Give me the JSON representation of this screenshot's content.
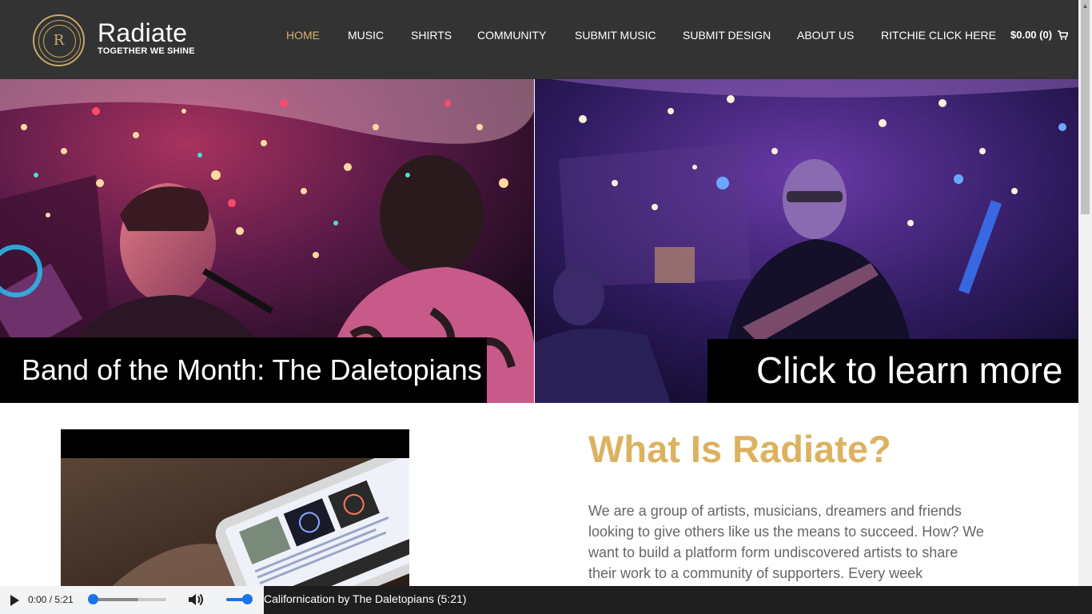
{
  "brand": {
    "logo_letter": "R",
    "name": "Radiate",
    "tagline": "TOGETHER WE SHINE"
  },
  "nav": {
    "items": [
      {
        "label": "HOME",
        "active": true
      },
      {
        "label": "MUSIC",
        "active": false
      },
      {
        "label": "SHIRTS",
        "active": false
      },
      {
        "label": "COMMUNITY",
        "active": false
      },
      {
        "label": "SUBMIT MUSIC",
        "active": false
      },
      {
        "label": "SUBMIT DESIGN",
        "active": false
      },
      {
        "label": "ABOUT US",
        "active": false
      },
      {
        "label": "RITCHIE CLICK HERE",
        "active": false
      }
    ],
    "cart_label": "$0.00 (0)",
    "cart_icon": "shopping-cart-icon"
  },
  "hero": {
    "left_caption": "Band of the Month: The Daletopians",
    "right_caption": "Click to learn more"
  },
  "about": {
    "title": "What Is Radiate?",
    "body": "We are a group of artists, musicians, dreamers and friends looking to give others like us the means to succeed. How? We want to build a platform form undiscovered artists to share their work to a community of supporters. Every week"
  },
  "player": {
    "time": "0:00 / 5:21",
    "progress": 0,
    "volume": 1,
    "track": "Californication by The Daletopians (5:21)"
  },
  "colors": {
    "header_bg": "#333333",
    "accent_gold": "#d6b06b",
    "title_gold": "#dcb25f",
    "body_text": "#666666"
  }
}
